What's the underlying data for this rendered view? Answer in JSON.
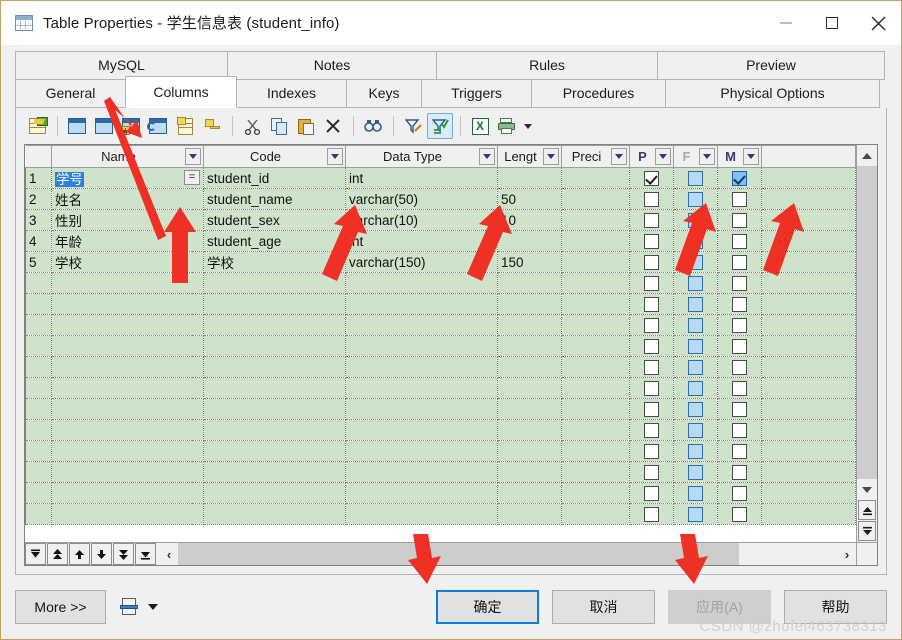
{
  "window": {
    "title": "Table Properties - 学生信息表 (student_info)",
    "icon": "table-icon",
    "controls": {
      "minimize": "minimize-icon",
      "maximize": "maximize-icon",
      "close": "close-icon"
    }
  },
  "tabs": {
    "top_row": [
      {
        "label": "MySQL",
        "selected": false
      },
      {
        "label": "Notes",
        "selected": false
      },
      {
        "label": "Rules",
        "selected": false
      },
      {
        "label": "Preview",
        "selected": false
      }
    ],
    "bottom_row": [
      {
        "label": "General",
        "selected": false
      },
      {
        "label": "Columns",
        "selected": true
      },
      {
        "label": "Indexes",
        "selected": false
      },
      {
        "label": "Keys",
        "selected": false
      },
      {
        "label": "Triggers",
        "selected": false
      },
      {
        "label": "Procedures",
        "selected": false
      },
      {
        "label": "Physical Options",
        "selected": false
      }
    ]
  },
  "toolbar": {
    "buttons": [
      {
        "name": "properties-icon",
        "active": false
      },
      {
        "name": "insert-column-before-icon",
        "active": false
      },
      {
        "name": "insert-column-after-icon",
        "active": false
      },
      {
        "name": "add-column-icon",
        "active": false
      },
      {
        "name": "refresh-column-icon",
        "active": false
      },
      {
        "name": "note-icon",
        "active": false
      },
      {
        "name": "key-icon",
        "active": false
      },
      {
        "name": "cut-icon",
        "active": false
      },
      {
        "name": "copy-icon",
        "active": false
      },
      {
        "name": "paste-icon",
        "active": false
      },
      {
        "name": "delete-icon",
        "active": false
      },
      {
        "name": "find-icon",
        "active": false
      },
      {
        "name": "filter-edit-icon",
        "active": false
      },
      {
        "name": "filter-apply-icon",
        "active": true
      },
      {
        "name": "excel-export-icon",
        "active": false
      },
      {
        "name": "print-icon",
        "active": false
      }
    ],
    "print_dropdown": "chevron-down-icon"
  },
  "grid": {
    "columns": [
      {
        "key": "rownum",
        "label": "",
        "dropdown": false
      },
      {
        "key": "name",
        "label": "Name",
        "dropdown": true
      },
      {
        "key": "code",
        "label": "Code",
        "dropdown": true
      },
      {
        "key": "datatype",
        "label": "Data Type",
        "dropdown": true
      },
      {
        "key": "length",
        "label": "Lengt",
        "dropdown": true
      },
      {
        "key": "precision",
        "label": "Preci",
        "dropdown": true
      },
      {
        "key": "p",
        "label": "P",
        "dropdown": true
      },
      {
        "key": "f",
        "label": "F",
        "dropdown": true
      },
      {
        "key": "m",
        "label": "M",
        "dropdown": true
      }
    ],
    "rows": [
      {
        "num": "1",
        "name": "学号",
        "name_selected": true,
        "code": "student_id",
        "datatype": "int",
        "length": "",
        "precision": "",
        "p": "checked",
        "f": "blue",
        "m": "checked-blue"
      },
      {
        "num": "2",
        "name": "姓名",
        "name_selected": false,
        "code": "student_name",
        "datatype": "varchar(50)",
        "length": "50",
        "precision": "",
        "p": "empty",
        "f": "blue",
        "m": "empty"
      },
      {
        "num": "3",
        "name": "性别",
        "name_selected": false,
        "code": "student_sex",
        "datatype": "varchar(10)",
        "length": "10",
        "precision": "",
        "p": "empty",
        "f": "blue",
        "m": "empty"
      },
      {
        "num": "4",
        "name": "年龄",
        "name_selected": false,
        "code": "student_age",
        "datatype": "int",
        "length": "",
        "precision": "",
        "p": "empty",
        "f": "blue",
        "m": "empty"
      },
      {
        "num": "5",
        "name": "学校",
        "name_selected": false,
        "code": "学校",
        "datatype": "varchar(150)",
        "length": "150",
        "precision": "",
        "p": "empty",
        "f": "blue",
        "m": "empty"
      }
    ],
    "empty_row_count": 12,
    "equals_button_label": "=",
    "scrollbars": {
      "vertical": {
        "up": "chevron-up-icon",
        "down": "chevron-down-icon",
        "top": "scroll-top-icon",
        "bottom": "scroll-bottom-icon"
      },
      "horizontal": {
        "left": "scroll-left-icon",
        "right": "scroll-right-icon"
      }
    },
    "nav_buttons": [
      "first-record-icon",
      "prev-page-icon",
      "prev-record-icon",
      "next-record-icon",
      "next-page-icon",
      "last-record-icon"
    ]
  },
  "footer": {
    "more_label": "More >>",
    "print_icon": "print-setup-icon",
    "print_caret": "chevron-down-icon",
    "buttons": [
      {
        "label": "确定",
        "state": "focused"
      },
      {
        "label": "取消",
        "state": "normal"
      },
      {
        "label": "应用(A)",
        "state": "disabled"
      },
      {
        "label": "帮助",
        "state": "normal"
      }
    ]
  },
  "watermark": "CSDN @zhufei463738313",
  "colors": {
    "grid_row_bg": "#cfe3cb",
    "selection_blue": "#2a7fe0",
    "focus_border": "#0a7ce0",
    "annotation_red": "#ee3124",
    "window_border": "#c8a062"
  }
}
